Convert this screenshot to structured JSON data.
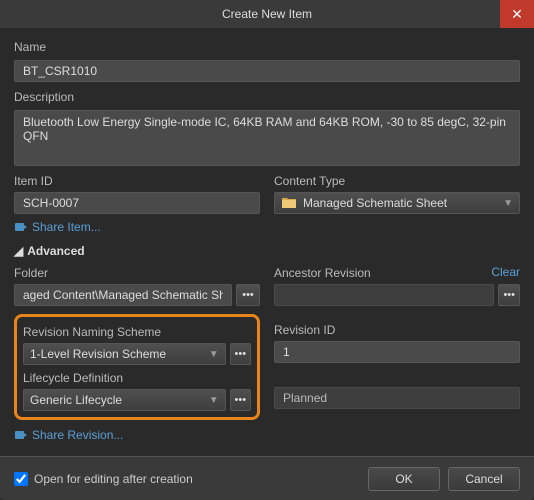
{
  "title": "Create New Item",
  "name": {
    "label": "Name",
    "value": "BT_CSR1010"
  },
  "description": {
    "label": "Description",
    "value": "Bluetooth Low Energy Single-mode IC, 64KB RAM and 64KB ROM, -30 to 85 degC, 32-pin QFN"
  },
  "itemId": {
    "label": "Item ID",
    "value": "SCH-0007"
  },
  "contentType": {
    "label": "Content Type",
    "value": "Managed Schematic Sheet"
  },
  "shareItem": "Share Item...",
  "advanced": "Advanced",
  "folder": {
    "label": "Folder",
    "value": "aged Content\\Managed Schematic Sheets"
  },
  "ancestorRevision": {
    "label": "Ancestor Revision",
    "clear": "Clear",
    "value": ""
  },
  "revisionNaming": {
    "label": "Revision Naming Scheme",
    "value": "1-Level Revision Scheme"
  },
  "revisionId": {
    "label": "Revision ID",
    "value": "1"
  },
  "lifecycle": {
    "label": "Lifecycle Definition",
    "value": "Generic Lifecycle",
    "status": "Planned"
  },
  "shareRevision": "Share Revision...",
  "openAfter": "Open for editing after creation",
  "buttons": {
    "ok": "OK",
    "cancel": "Cancel"
  }
}
